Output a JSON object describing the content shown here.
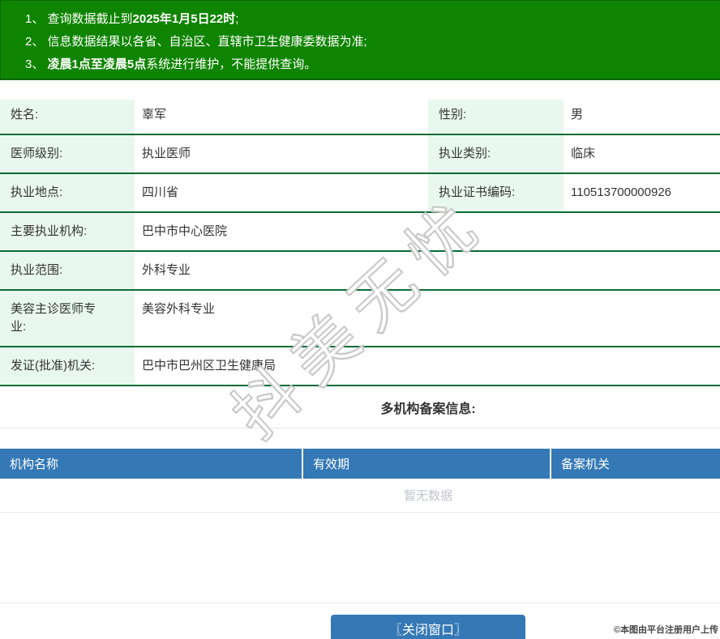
{
  "banner": {
    "notices": [
      {
        "pre": "1、 查询数据截止到",
        "bold": "2025年1月5日22时",
        "post": ";"
      },
      {
        "pre": "2、 信息数据结果以各省、自治区、直辖市卫生健康委数据为准;",
        "bold": "",
        "post": ""
      },
      {
        "pre": "3、 ",
        "bold": "凌晨1点至凌晨5点",
        "post": "系统进行维护，不能提供查询。"
      }
    ]
  },
  "profile": {
    "pair_rows": [
      {
        "label1": "姓名:",
        "value1": "辜军",
        "label2": "性别:",
        "value2": "男"
      },
      {
        "label1": "医师级别:",
        "value1": "执业医师",
        "label2": "执业类别:",
        "value2": "临床"
      },
      {
        "label1": "执业地点:",
        "value1": "四川省",
        "label2": "执业证书编码:",
        "value2": "110513700000926"
      }
    ],
    "full_rows": [
      {
        "label": "主要执业机构:",
        "value": "巴中市中心医院"
      },
      {
        "label": "执业范围:",
        "value": "外科专业"
      },
      {
        "label": "美容主诊医师专业:",
        "value": "美容外科专业"
      },
      {
        "label": "发证(批准)机关:",
        "value": "巴中市巴州区卫生健康局"
      }
    ]
  },
  "records": {
    "title": "多机构备案信息:",
    "headers": [
      "机构名称",
      "有效期",
      "备案机关"
    ],
    "empty_text": "暂无数据"
  },
  "footer": {
    "close_button_label": "〖关闭窗口〗",
    "copyright": "©本图由平台注册用户上传"
  },
  "watermark": {
    "text": "抖美无忧"
  },
  "colors": {
    "banner_green": "#0f8400",
    "row_border_green": "#0a6c35",
    "label_bg_mint": "#e9f8ef",
    "header_blue": "#3478b5",
    "empty_text_gray": "#c0c4cc"
  }
}
